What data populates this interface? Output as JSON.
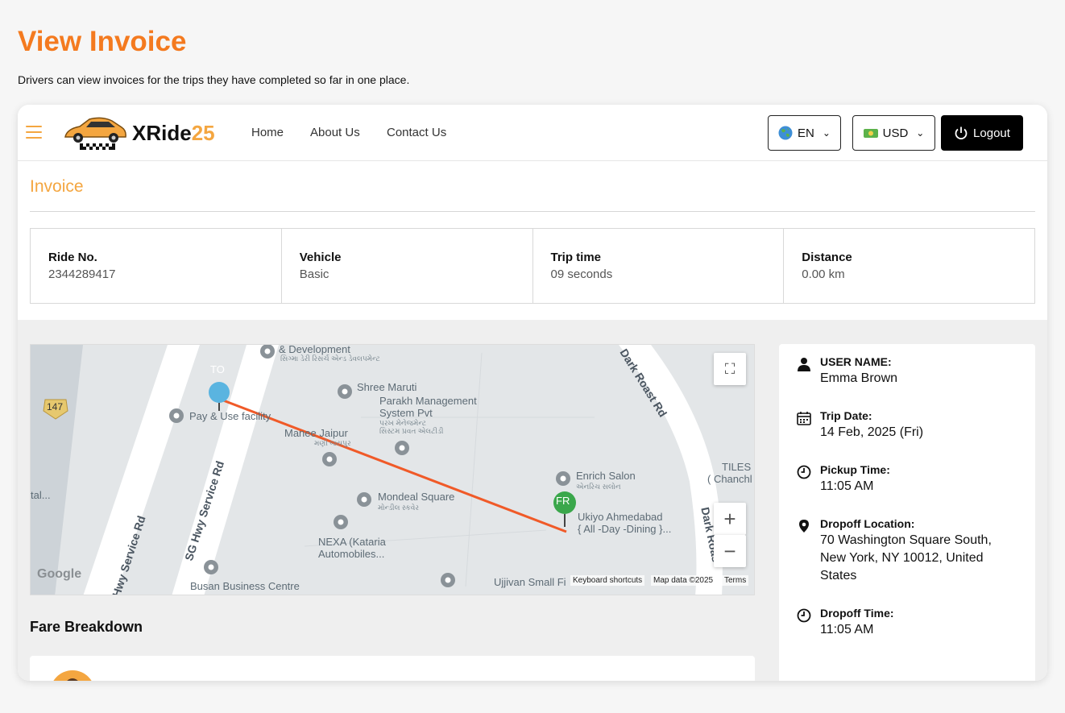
{
  "page": {
    "title": "View Invoice",
    "subtitle": "Drivers can view invoices for the trips they have completed so far in one place."
  },
  "navbar": {
    "brand_main": "XRide",
    "brand_accent": "25",
    "links": [
      "Home",
      "About Us",
      "Contact Us"
    ],
    "language": "EN",
    "currency": "USD",
    "logout_label": "Logout",
    "language_icon": "globe-icon",
    "currency_icon": "money-icon"
  },
  "invoice": {
    "heading": "Invoice",
    "stats": [
      {
        "label": "Ride No.",
        "value": "2344289417"
      },
      {
        "label": "Vehicle",
        "value": "Basic"
      },
      {
        "label": "Trip time",
        "value": "09 seconds"
      },
      {
        "label": "Distance",
        "value": "0.00 km"
      }
    ]
  },
  "map": {
    "marker_to": "TO",
    "marker_from": "FR",
    "route_color": "#f05a28",
    "labels": {
      "dev": "& Development",
      "dev_sub": "સિગ્મા ડેરી રિસર્ચ એન્ડ ડેવલપમેન્ટ",
      "shree": "Shree Maruti",
      "parakh": "Parakh Management",
      "parakh2": "System Pvt",
      "parakh_sub": "પરખ મેનેજમેન્ટ",
      "parakh_sub2": "સિસ્ટમ પ્રવત એલટીડી",
      "pay": "Pay & Use facility",
      "manee": "Manee Jaipur",
      "manee_sub": "મણી જયપુર",
      "mondeal": "Mondeal Square",
      "mondeal_sub": "મોન્ડીલ સ્કવેર",
      "nexa": "NEXA (Kataria",
      "nexa2": "Automobiles...",
      "enrich": "Enrich Salon",
      "enrich_sub": "એનરિચ સલોન",
      "ukiyo": "Ukiyo Ahmedabad",
      "ukiyo2": "{ All -Day -Dining }...",
      "tiles": "TILES",
      "chanch": "( Chanchl",
      "tal": "tal...",
      "ujjivan": "Ujjivan Small Fi",
      "busan": "Busan Business Centre",
      "road1": "SG Hwy Service Rd",
      "road2": "Hwy Service Rd",
      "road3": "Dark Roast Rd",
      "road4": "Dark Roas",
      "hwy_shield": "147",
      "google": "Google"
    },
    "attribution": {
      "shortcuts": "Keyboard shortcuts",
      "data": "Map data ©2025",
      "terms": "Terms"
    }
  },
  "fare": {
    "heading": "Fare Breakdown"
  },
  "trip_info": [
    {
      "icon": "user-icon",
      "label": "USER NAME:",
      "value": "Emma Brown"
    },
    {
      "icon": "calendar-icon",
      "label": "Trip Date:",
      "value": "14 Feb, 2025 (Fri)"
    },
    {
      "icon": "clock-icon",
      "label": "Pickup Time:",
      "value": "11:05 AM"
    },
    {
      "icon": "location-pin-icon",
      "label": "Dropoff Location:",
      "value": "70 Washington Square South, New York, NY 10012, United States"
    },
    {
      "icon": "clock-icon",
      "label": "Dropoff Time:",
      "value": "11:05 AM"
    }
  ]
}
